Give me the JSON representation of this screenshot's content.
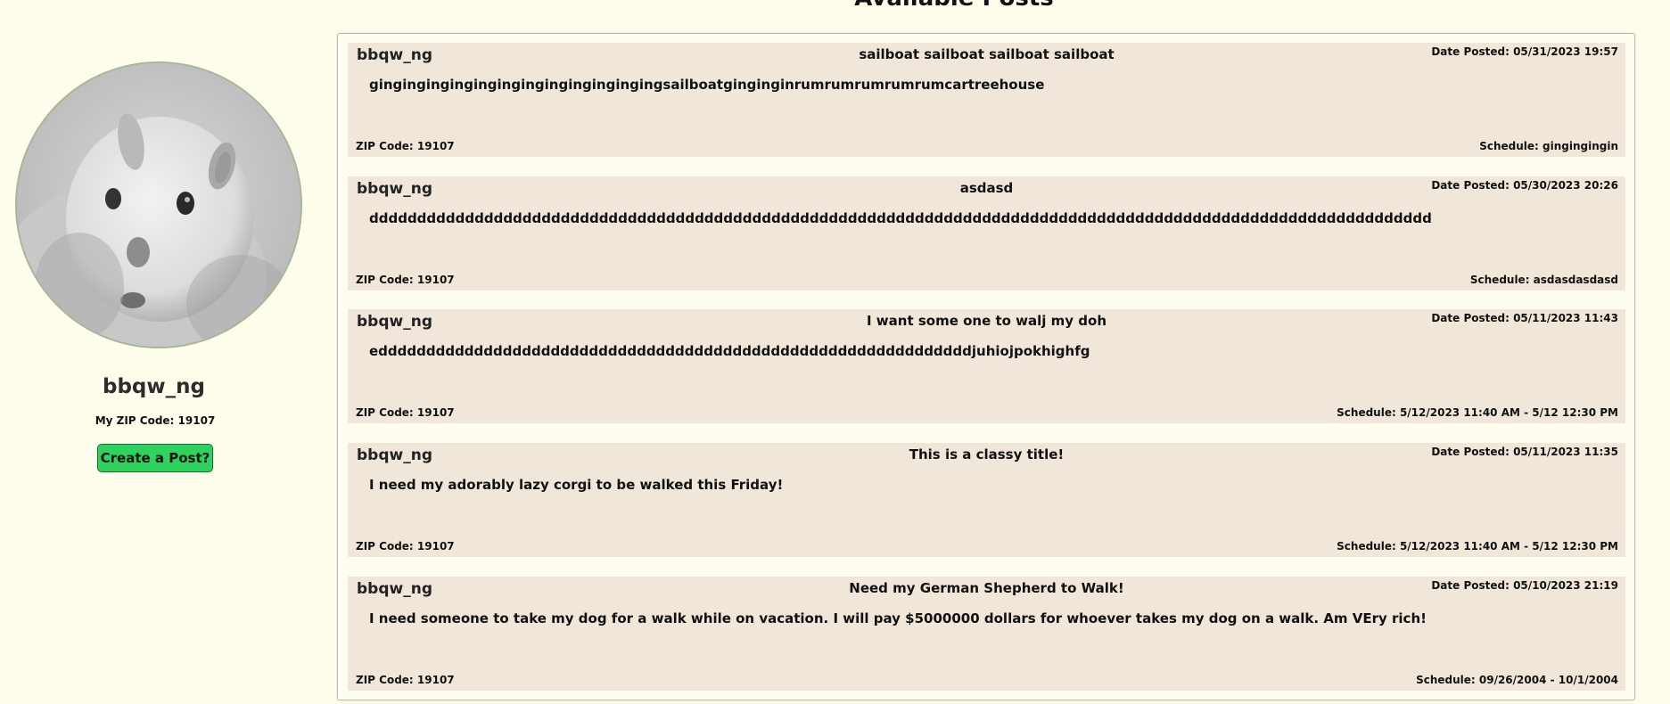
{
  "profile": {
    "username": "bbqw_ng",
    "zip_text": "My ZIP Code: 19107",
    "create_button_label": "Create a Post?"
  },
  "posts_section": {
    "title": "Available Posts"
  },
  "posts": [
    {
      "user": "bbqw_ng",
      "title": "sailboat sailboat sailboat sailboat",
      "date": "Date Posted: 05/31/2023 19:57",
      "body": "gingingingingingingingingingingingingsailboatginginginrumrumrumrumrumcartreehouse",
      "zip": "ZIP Code: 19107",
      "schedule": "Schedule: gingingingin"
    },
    {
      "user": "bbqw_ng",
      "title": "asdasd",
      "date": "Date Posted: 05/30/2023 20:26",
      "body": "ddddddddddddddddddddddddddddddddddddddddddddddddddddddddddddddddddddddddddddddddddddddddddddddddddddddddddddddd",
      "zip": "ZIP Code: 19107",
      "schedule": "Schedule: asdasdasdasd"
    },
    {
      "user": "bbqw_ng",
      "title": "I want some one to walj my doh",
      "date": "Date Posted: 05/11/2023 11:43",
      "body": "eddddddddddddddddddddddddddddddddddddddddddddddddddddddddddddddjuhiojpokhighfg",
      "zip": "ZIP Code: 19107",
      "schedule": "Schedule: 5/12/2023 11:40 AM - 5/12 12:30 PM"
    },
    {
      "user": "bbqw_ng",
      "title": "This is a classy title!",
      "date": "Date Posted: 05/11/2023 11:35",
      "body": "I need my adorably lazy corgi to be walked this Friday!",
      "zip": "ZIP Code: 19107",
      "schedule": "Schedule: 5/12/2023 11:40 AM - 5/12 12:30 PM"
    },
    {
      "user": "bbqw_ng",
      "title": "Need my German Shepherd to Walk!",
      "date": "Date Posted: 05/10/2023 21:19",
      "body": "I need someone to take my dog for a walk while on vacation. I will pay $5000000 dollars for whoever takes my dog on a walk. Am VEry rich!",
      "zip": "ZIP Code: 19107",
      "schedule": "Schedule: 09/26/2004 - 10/1/2004"
    }
  ],
  "colors": {
    "page_background": "#fffdec",
    "post_background": "#f0e7da",
    "button_green": "#2dd35c"
  },
  "icons": {
    "avatar": "hamster-photo"
  }
}
